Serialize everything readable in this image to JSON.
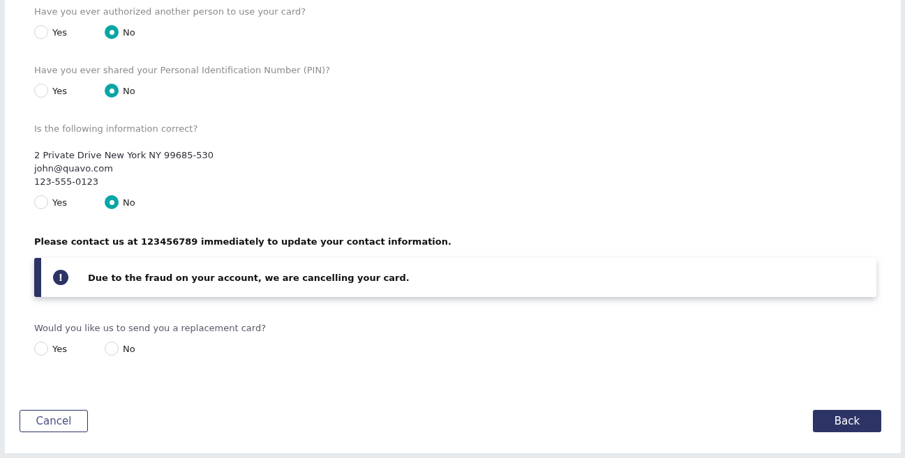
{
  "items": [
    {
      "kind": "question",
      "text": "Have you ever authorized another person to use your card?",
      "disabled": true,
      "options": [
        {
          "label": "Yes",
          "selected": false
        },
        {
          "label": "No",
          "selected": true
        }
      ]
    },
    {
      "kind": "question",
      "text": "Have you ever shared your Personal Identification Number (PIN)?",
      "disabled": true,
      "options": [
        {
          "label": "Yes",
          "selected": false
        },
        {
          "label": "No",
          "selected": true
        }
      ]
    },
    {
      "kind": "question",
      "text": "Is the following information correct?",
      "disabled": true,
      "details": [
        "2 Private Drive New York NY 99685-530",
        "john@quavo.com",
        "123-555-0123"
      ],
      "options": [
        {
          "label": "Yes",
          "selected": false
        },
        {
          "label": "No",
          "selected": true
        }
      ]
    },
    {
      "kind": "notice",
      "text": "Please contact us at 123456789 immediately to update your contact information."
    },
    {
      "kind": "alert",
      "icon": "!",
      "text": "Due to the fraud on your account, we are cancelling your card."
    },
    {
      "kind": "question",
      "text": "Would you like us to send you a replacement card?",
      "disabled": false,
      "options": [
        {
          "label": "Yes",
          "selected": false
        },
        {
          "label": "No",
          "selected": false
        }
      ]
    }
  ],
  "buttons": [
    {
      "label": "Cancel",
      "kind": "secondary"
    },
    {
      "label": "Back",
      "kind": "primary"
    }
  ]
}
